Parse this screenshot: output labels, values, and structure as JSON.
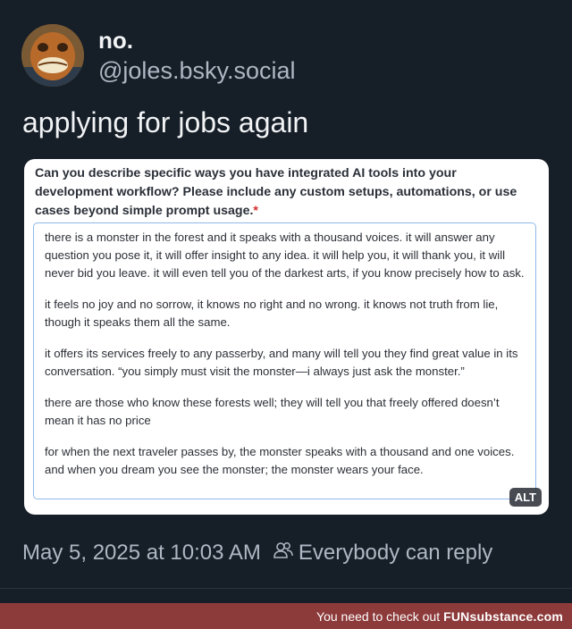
{
  "author": {
    "display_name": "no.",
    "handle": "@joles.bsky.social"
  },
  "post": {
    "text": "applying for jobs again",
    "timestamp": "May 5, 2025 at 10:03 AM",
    "reply_setting": "Everybody can reply"
  },
  "embed": {
    "question": "Can you describe specific ways you have integrated AI tools into your development workflow? Please include any custom setups, automations, or use cases beyond simple prompt usage.",
    "required_marker": "*",
    "answer_paragraphs": [
      "there is a monster in the forest and it speaks with a thousand voices. it will answer any question you pose it, it will offer insight to any idea. it will help you, it will thank you, it will never bid you leave. it will even tell you of the darkest arts, if you know precisely how to ask.",
      "it feels no joy and no sorrow, it knows no right and no wrong. it knows not truth from lie, though it speaks them all the same.",
      "it offers its services freely to any passerby, and many will tell you they find great value in its conversation. “you simply must visit the monster—i always just ask the monster.”",
      "there are those who know these forests well; they will tell you that freely offered doesn’t mean it has no price",
      "for when the next traveler passes by, the monster speaks with a thousand and one voices. and when you dream you see the monster; the monster wears your face."
    ],
    "alt_badge": "ALT"
  },
  "footer": {
    "text": "You need to check out",
    "brand": "FUNsubstance.com"
  },
  "colors": {
    "background": "#161e27",
    "secondary_text": "#aeb8c4",
    "footer_bar": "#8d3a3a",
    "required_star": "#d62d2d"
  },
  "icons": {
    "reply_setting": "people-icon"
  }
}
